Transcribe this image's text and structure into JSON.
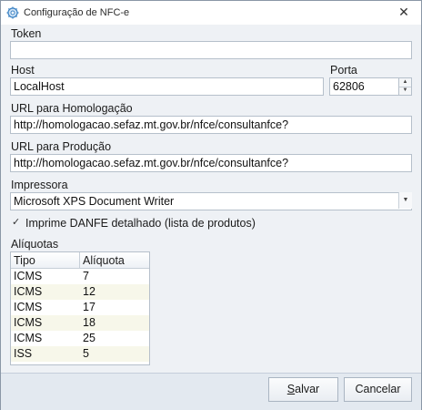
{
  "window": {
    "title": "Configuração de NFC-e",
    "close_glyph": "✕"
  },
  "form": {
    "token": {
      "label": "Token",
      "value": ""
    },
    "host": {
      "label": "Host",
      "value": "LocalHost"
    },
    "porta": {
      "label": "Porta",
      "value": "62806"
    },
    "url_homologacao": {
      "label": "URL para Homologação",
      "value": "http://homologacao.sefaz.mt.gov.br/nfce/consultanfce?"
    },
    "url_producao": {
      "label": "URL para Produção",
      "value": "http://homologacao.sefaz.mt.gov.br/nfce/consultanfce?"
    },
    "impressora": {
      "label": "Impressora",
      "value": "Microsoft XPS Document Writer"
    },
    "danfe_checkbox": {
      "label": "Imprime DANFE detalhado (lista de produtos)",
      "checked": true
    }
  },
  "aliquotas": {
    "label": "Alíquotas",
    "columns": [
      "Tipo",
      "Alíquota"
    ],
    "rows": [
      [
        "ICMS",
        "7"
      ],
      [
        "ICMS",
        "12"
      ],
      [
        "ICMS",
        "17"
      ],
      [
        "ICMS",
        "18"
      ],
      [
        "ICMS",
        "25"
      ],
      [
        "ISS",
        "5"
      ]
    ]
  },
  "buttons": {
    "save_prefix": "S",
    "save_rest": "alvar",
    "cancel": "Cancelar"
  },
  "icons": {
    "title": "gear-icon",
    "close": "close-icon",
    "spin_up": "triangle-up-icon",
    "spin_down": "triangle-down-icon",
    "dropdown": "chevron-down-icon",
    "check": "check-icon"
  }
}
